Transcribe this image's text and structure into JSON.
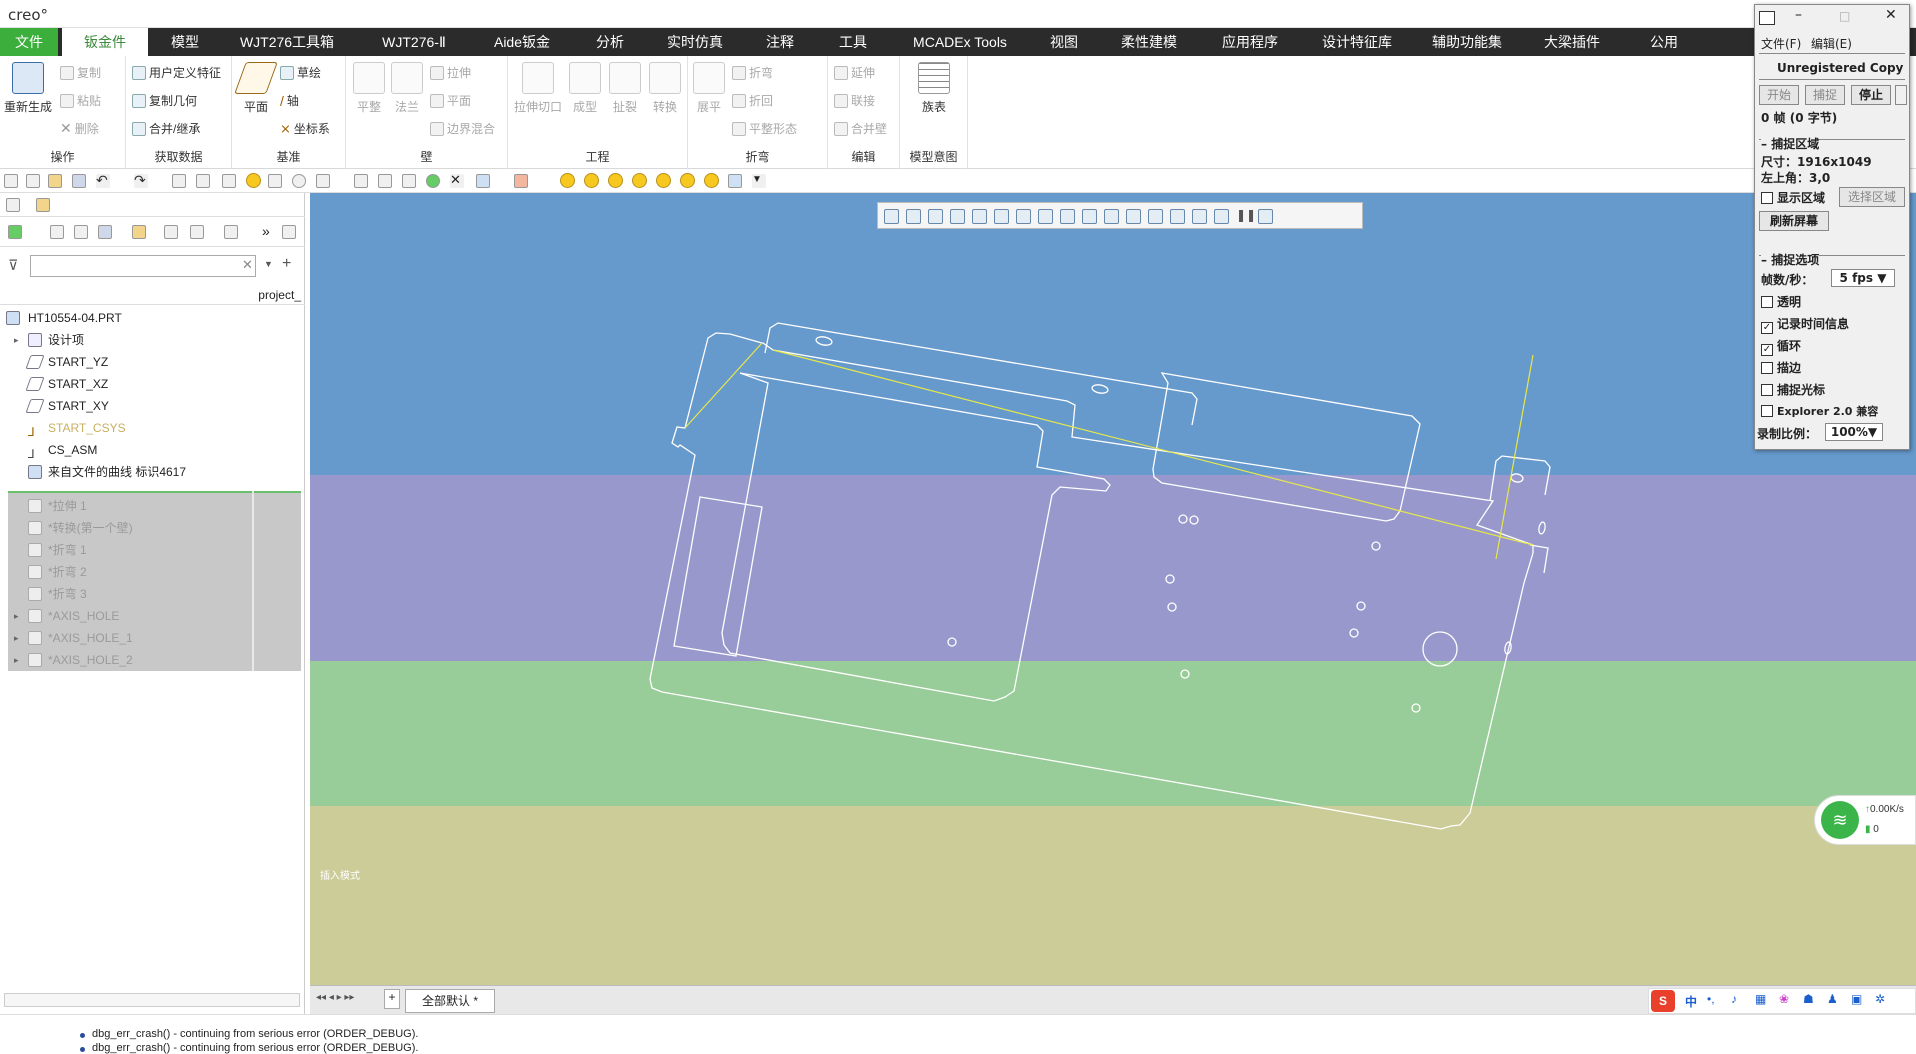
{
  "app": {
    "logo": "creo°"
  },
  "menu": [
    "文件",
    "钣金件",
    "模型",
    "WJT276工具箱",
    "WJT276-Ⅱ",
    "Aide钣金",
    "分析",
    "实时仿真",
    "注释",
    "工具",
    "MCADEx Tools",
    "视图",
    "柔性建模",
    "应用程序",
    "设计特征库",
    "辅助功能集",
    "大梁插件",
    "公用"
  ],
  "ribbon": {
    "regen": "重新生成",
    "ops": {
      "copy": "复制",
      "paste": "粘贴",
      "delete": "删除",
      "label": "操作"
    },
    "getdata": {
      "udf": "用户定义特征",
      "copygeom": "复制几何",
      "merge": "合并/继承",
      "label": "获取数据"
    },
    "datum": {
      "plane": "平面",
      "sketch": "草绘",
      "axis": "轴",
      "csys": "坐标系",
      "label": "基准"
    },
    "wall": {
      "flat": "平整",
      "flange": "法兰",
      "extrude": "拉伸",
      "planar": "平面",
      "blend": "边界混合",
      "label": "壁"
    },
    "eng": {
      "cut": "拉伸切口",
      "form": "成型",
      "rip": "扯裂",
      "convert": "转换",
      "label": "工程"
    },
    "bend": {
      "unbend": "展平",
      "bend": "折弯",
      "bendback": "折回",
      "flatform": "平整形态",
      "label": "折弯"
    },
    "edit": {
      "extend": "延伸",
      "join": "联接",
      "mergewall": "合并壁",
      "label": "编辑"
    },
    "intent": {
      "family": "族表",
      "label": "模型意图"
    }
  },
  "tree": {
    "filter_col": "project_",
    "items": [
      {
        "label": "HT10554-04.PRT",
        "dim": false
      },
      {
        "label": "设计项",
        "dim": false
      },
      {
        "label": "START_YZ",
        "dim": false
      },
      {
        "label": "START_XZ",
        "dim": false
      },
      {
        "label": "START_XY",
        "dim": false
      },
      {
        "label": "START_CSYS",
        "dim": true
      },
      {
        "label": "CS_ASM",
        "dim": false
      },
      {
        "label": "来自文件的曲线 标识4617",
        "dim": false
      },
      {
        "label": "*拉伸 1",
        "dim": true
      },
      {
        "label": "*转换(第一个壁)",
        "dim": true
      },
      {
        "label": "*折弯 1",
        "dim": true
      },
      {
        "label": "*折弯 2",
        "dim": true
      },
      {
        "label": "*折弯 3",
        "dim": true
      },
      {
        "label": "*AXIS_HOLE",
        "dim": true
      },
      {
        "label": "*AXIS_HOLE_1",
        "dim": true
      },
      {
        "label": "*AXIS_HOLE_2",
        "dim": true
      }
    ]
  },
  "viewport": {
    "mode_label": "插入模式",
    "colors": {
      "b1": "#6699cc",
      "b2": "#9898cc",
      "b3": "#98cc98",
      "b4": "#cccc98"
    }
  },
  "bottom": {
    "tab": "全部默认 *"
  },
  "status": {
    "messages": [
      "dbg_err_crash() - continuing from serious error (ORDER_DEBUG).",
      "dbg_err_crash() - continuing from serious error (ORDER_DEBUG)."
    ]
  },
  "capture": {
    "menu_file": "文件(F)",
    "menu_edit": "编辑(E)",
    "banner": "Unregistered Copy",
    "start": "开始",
    "capture": "捕捉",
    "stop": "停止",
    "frames": "0 帧 (0 字节)",
    "region_title": "捕捉区域",
    "size": "尺寸：1916x1049",
    "topleft": "左上角：3,0",
    "show_region": "显示区域",
    "select_region": "选择区域",
    "refresh": "刷新屏幕",
    "options_title": "捕捉选项",
    "fps_label": "帧数/秒：",
    "fps_value": "5 fps",
    "transparent": "透明",
    "record_time": "记录时间信息",
    "loop": "循环",
    "border": "描边",
    "capture_cursor": "捕捉光标",
    "explorer": "Explorer 2.0 兼容",
    "scale_label": "录制比例：",
    "scale_value": "100%"
  },
  "network": {
    "speed": "0.00K/s",
    "count": "0"
  },
  "ime": {
    "lang": "中"
  }
}
